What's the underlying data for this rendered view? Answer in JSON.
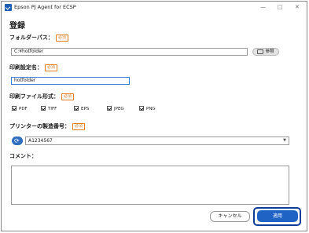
{
  "window": {
    "title": "Epson PJ Agent for ECSP",
    "controls": {
      "minimize": "—",
      "maximize": "□",
      "close": "✕"
    }
  },
  "page_title": "登録",
  "required_badge": "必須",
  "folder_path": {
    "label": "フォルダーパス：",
    "value": "C:¥hotfolder",
    "browse_label": "参照"
  },
  "print_setting": {
    "label": "印刷設定名：",
    "value": "hotfolder"
  },
  "file_format": {
    "label": "印刷ファイル形式：",
    "options": [
      {
        "label": "PDF",
        "checked": true
      },
      {
        "label": "TIFF",
        "checked": true
      },
      {
        "label": "EPS",
        "checked": true
      },
      {
        "label": "JPEG",
        "checked": true
      },
      {
        "label": "PNG",
        "checked": true
      }
    ]
  },
  "serial": {
    "label": "プリンターの製造番号：",
    "selected": "A1234567"
  },
  "comment": {
    "label": "コメント：",
    "value": ""
  },
  "buttons": {
    "cancel": "キャンセル",
    "apply": "適用"
  },
  "colors": {
    "accent": "#1f63c5",
    "focus": "#0b3d99",
    "required": "#e67e22"
  }
}
